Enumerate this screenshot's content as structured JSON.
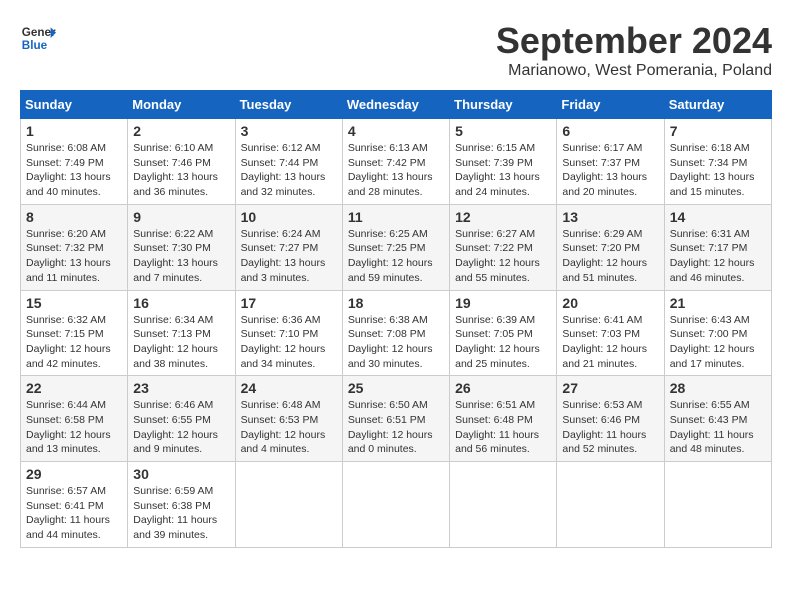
{
  "header": {
    "logo_line1": "General",
    "logo_line2": "Blue",
    "month_title": "September 2024",
    "subtitle": "Marianowo, West Pomerania, Poland"
  },
  "weekdays": [
    "Sunday",
    "Monday",
    "Tuesday",
    "Wednesday",
    "Thursday",
    "Friday",
    "Saturday"
  ],
  "weeks": [
    [
      {
        "day": "1",
        "info": "Sunrise: 6:08 AM\nSunset: 7:49 PM\nDaylight: 13 hours\nand 40 minutes."
      },
      {
        "day": "2",
        "info": "Sunrise: 6:10 AM\nSunset: 7:46 PM\nDaylight: 13 hours\nand 36 minutes."
      },
      {
        "day": "3",
        "info": "Sunrise: 6:12 AM\nSunset: 7:44 PM\nDaylight: 13 hours\nand 32 minutes."
      },
      {
        "day": "4",
        "info": "Sunrise: 6:13 AM\nSunset: 7:42 PM\nDaylight: 13 hours\nand 28 minutes."
      },
      {
        "day": "5",
        "info": "Sunrise: 6:15 AM\nSunset: 7:39 PM\nDaylight: 13 hours\nand 24 minutes."
      },
      {
        "day": "6",
        "info": "Sunrise: 6:17 AM\nSunset: 7:37 PM\nDaylight: 13 hours\nand 20 minutes."
      },
      {
        "day": "7",
        "info": "Sunrise: 6:18 AM\nSunset: 7:34 PM\nDaylight: 13 hours\nand 15 minutes."
      }
    ],
    [
      {
        "day": "8",
        "info": "Sunrise: 6:20 AM\nSunset: 7:32 PM\nDaylight: 13 hours\nand 11 minutes."
      },
      {
        "day": "9",
        "info": "Sunrise: 6:22 AM\nSunset: 7:30 PM\nDaylight: 13 hours\nand 7 minutes."
      },
      {
        "day": "10",
        "info": "Sunrise: 6:24 AM\nSunset: 7:27 PM\nDaylight: 13 hours\nand 3 minutes."
      },
      {
        "day": "11",
        "info": "Sunrise: 6:25 AM\nSunset: 7:25 PM\nDaylight: 12 hours\nand 59 minutes."
      },
      {
        "day": "12",
        "info": "Sunrise: 6:27 AM\nSunset: 7:22 PM\nDaylight: 12 hours\nand 55 minutes."
      },
      {
        "day": "13",
        "info": "Sunrise: 6:29 AM\nSunset: 7:20 PM\nDaylight: 12 hours\nand 51 minutes."
      },
      {
        "day": "14",
        "info": "Sunrise: 6:31 AM\nSunset: 7:17 PM\nDaylight: 12 hours\nand 46 minutes."
      }
    ],
    [
      {
        "day": "15",
        "info": "Sunrise: 6:32 AM\nSunset: 7:15 PM\nDaylight: 12 hours\nand 42 minutes."
      },
      {
        "day": "16",
        "info": "Sunrise: 6:34 AM\nSunset: 7:13 PM\nDaylight: 12 hours\nand 38 minutes."
      },
      {
        "day": "17",
        "info": "Sunrise: 6:36 AM\nSunset: 7:10 PM\nDaylight: 12 hours\nand 34 minutes."
      },
      {
        "day": "18",
        "info": "Sunrise: 6:38 AM\nSunset: 7:08 PM\nDaylight: 12 hours\nand 30 minutes."
      },
      {
        "day": "19",
        "info": "Sunrise: 6:39 AM\nSunset: 7:05 PM\nDaylight: 12 hours\nand 25 minutes."
      },
      {
        "day": "20",
        "info": "Sunrise: 6:41 AM\nSunset: 7:03 PM\nDaylight: 12 hours\nand 21 minutes."
      },
      {
        "day": "21",
        "info": "Sunrise: 6:43 AM\nSunset: 7:00 PM\nDaylight: 12 hours\nand 17 minutes."
      }
    ],
    [
      {
        "day": "22",
        "info": "Sunrise: 6:44 AM\nSunset: 6:58 PM\nDaylight: 12 hours\nand 13 minutes."
      },
      {
        "day": "23",
        "info": "Sunrise: 6:46 AM\nSunset: 6:55 PM\nDaylight: 12 hours\nand 9 minutes."
      },
      {
        "day": "24",
        "info": "Sunrise: 6:48 AM\nSunset: 6:53 PM\nDaylight: 12 hours\nand 4 minutes."
      },
      {
        "day": "25",
        "info": "Sunrise: 6:50 AM\nSunset: 6:51 PM\nDaylight: 12 hours\nand 0 minutes."
      },
      {
        "day": "26",
        "info": "Sunrise: 6:51 AM\nSunset: 6:48 PM\nDaylight: 11 hours\nand 56 minutes."
      },
      {
        "day": "27",
        "info": "Sunrise: 6:53 AM\nSunset: 6:46 PM\nDaylight: 11 hours\nand 52 minutes."
      },
      {
        "day": "28",
        "info": "Sunrise: 6:55 AM\nSunset: 6:43 PM\nDaylight: 11 hours\nand 48 minutes."
      }
    ],
    [
      {
        "day": "29",
        "info": "Sunrise: 6:57 AM\nSunset: 6:41 PM\nDaylight: 11 hours\nand 44 minutes."
      },
      {
        "day": "30",
        "info": "Sunrise: 6:59 AM\nSunset: 6:38 PM\nDaylight: 11 hours\nand 39 minutes."
      },
      null,
      null,
      null,
      null,
      null
    ]
  ]
}
